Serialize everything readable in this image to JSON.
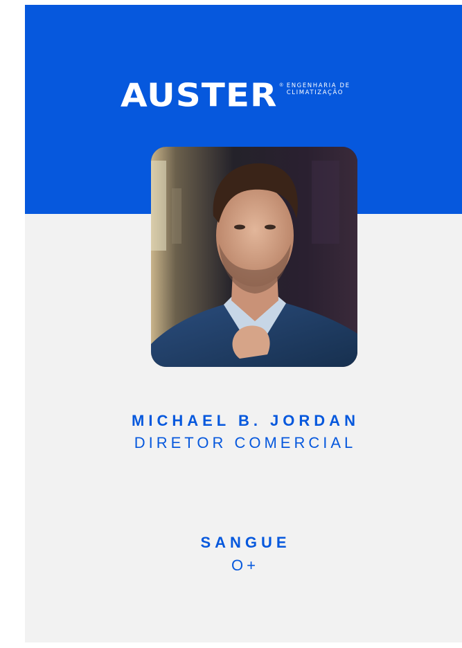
{
  "brand": {
    "wordmark": "AUSTER",
    "registered_mark": "®",
    "tagline_line1": "ENGENHARIA DE",
    "tagline_line2": "CLIMATIZAÇÃO",
    "primary_color": "#0658dd"
  },
  "employee": {
    "photo_icon": "portrait-photo",
    "name": "MICHAEL B. JORDAN",
    "role": "DIRETOR COMERCIAL"
  },
  "blood": {
    "label": "SANGUE",
    "value": "O+"
  }
}
